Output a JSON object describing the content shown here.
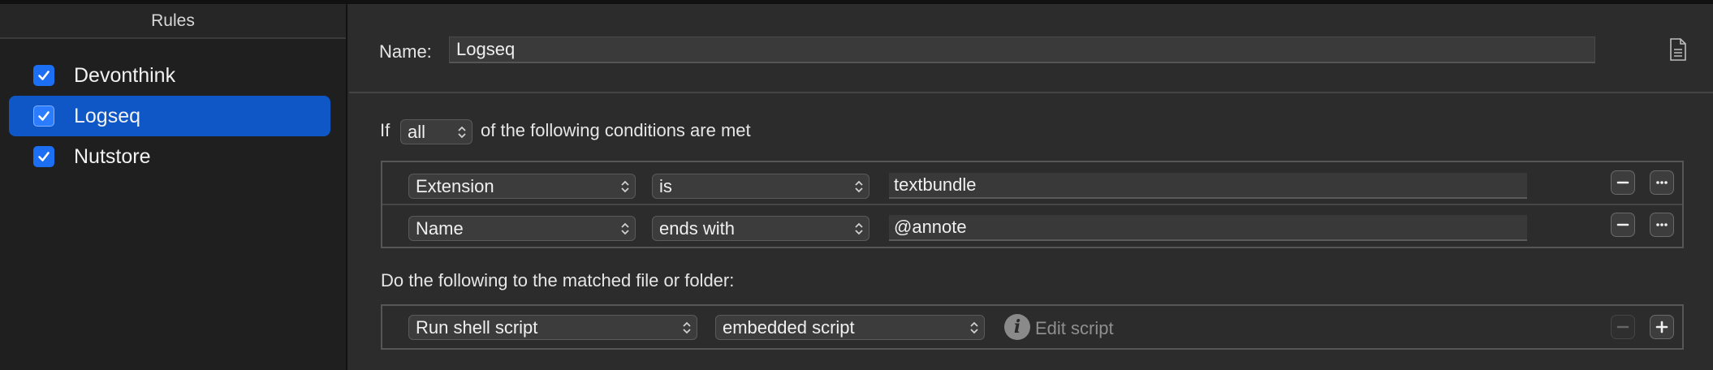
{
  "sidebar": {
    "header": "Rules",
    "items": [
      {
        "label": "Devonthink",
        "checked": true,
        "selected": false
      },
      {
        "label": "Logseq",
        "checked": true,
        "selected": true
      },
      {
        "label": "Nutstore",
        "checked": true,
        "selected": false
      }
    ]
  },
  "editor": {
    "name_label": "Name:",
    "name_value": "Logseq",
    "conditions": {
      "prefix": "If",
      "match_mode": "all",
      "suffix": "of the following conditions are met",
      "rows": [
        {
          "attribute": "Extension",
          "operator": "is",
          "value": "textbundle"
        },
        {
          "attribute": "Name",
          "operator": "ends with",
          "value": "@annote"
        }
      ]
    },
    "actions": {
      "label": "Do the following to the matched file or folder:",
      "rows": [
        {
          "action": "Run shell script",
          "target": "embedded script",
          "edit_label": "Edit script",
          "info_glyph": "i"
        }
      ]
    }
  },
  "icons": {
    "checkbox": "checkmark-icon",
    "document": "document-icon",
    "remove": "minus-icon",
    "more": "ellipsis-icon",
    "add": "plus-icon",
    "info": "info-icon",
    "popup_arrows": "updown-chevrons-icon"
  },
  "colors": {
    "accent": "#0f57c7",
    "checkbox": "#1c6ef2",
    "sidebar_bg": "#1f1f1f",
    "panel_bg": "#2c2c2c"
  }
}
